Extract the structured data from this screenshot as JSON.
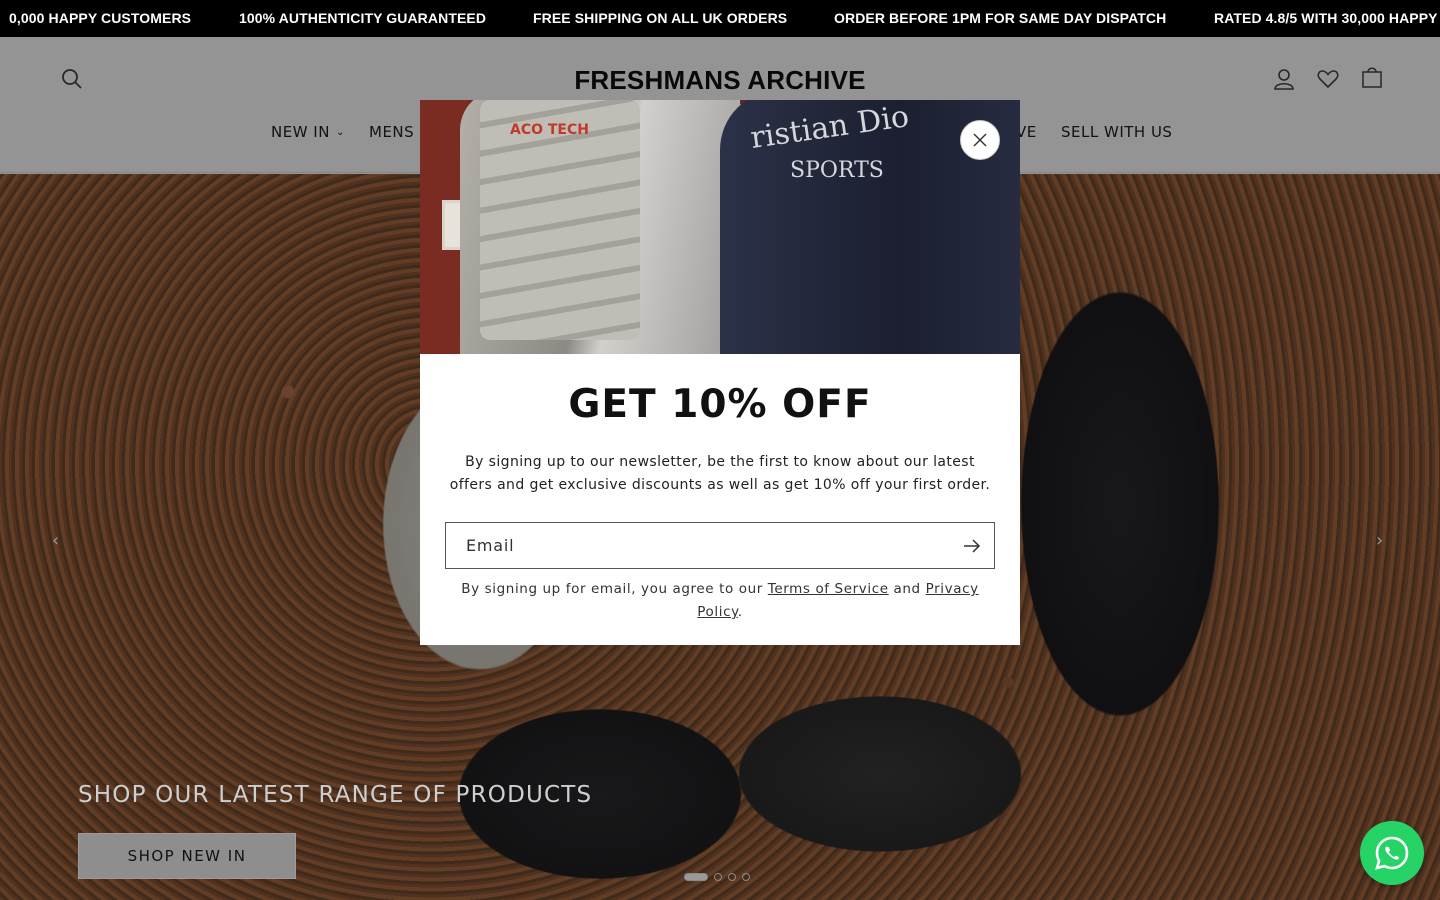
{
  "announcement": {
    "items": [
      "0,000 HAPPY CUSTOMERS",
      "100% AUTHENTICITY GUARANTEED",
      "FREE SHIPPING ON ALL UK ORDERS",
      "ORDER BEFORE 1PM FOR SAME DAY DISPATCH",
      "RATED 4.8/5 WITH 30,000 HAPPY"
    ]
  },
  "header": {
    "logo": "FRESHMANS ARCHIVE",
    "icons": [
      "search-icon",
      "account-icon",
      "wishlist-heart-icon",
      "cart-bag-icon"
    ],
    "nav": {
      "new_in": "NEW IN",
      "mens": "MENS",
      "partial_ve": "VE",
      "sell": "SELL WITH US"
    }
  },
  "hero": {
    "title": "SHOP OUR LATEST RANGE OF PRODUCTS",
    "button": "SHOP NEW IN",
    "slide_count": 4,
    "active_slide": 1
  },
  "modal": {
    "image_text_vest": "ACO TECH",
    "image_text_jacket_1": "ristian Dio",
    "image_text_jacket_2": "SPORTS",
    "title": "GET 10% OFF",
    "description": "By signing up to our newsletter, be the first to know about our latest offers and get exclusive discounts as well as get 10% off your first order.",
    "email_placeholder": "Email",
    "legal_prefix": "By signing up for email, you agree to our ",
    "terms_link": "Terms of Service",
    "legal_and": " and ",
    "privacy_link": "Privacy Policy",
    "legal_suffix": "."
  },
  "colors": {
    "announcement_bg": "#000000",
    "whatsapp": "#25d366"
  }
}
